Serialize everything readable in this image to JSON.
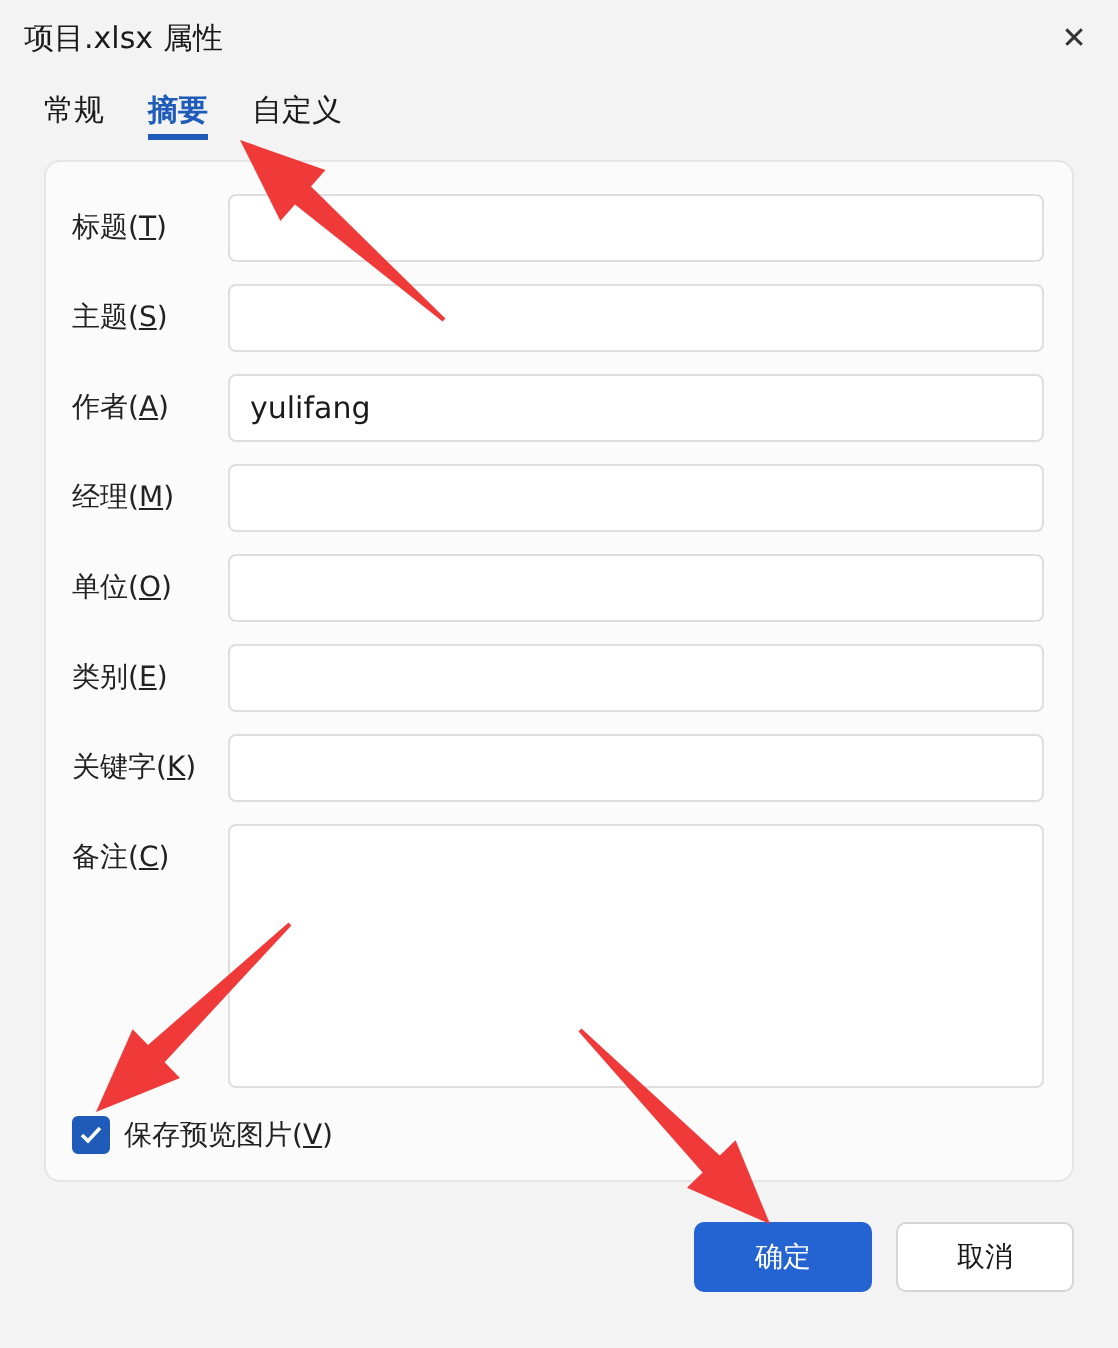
{
  "window": {
    "title": "项目.xlsx 属性",
    "close": "✕"
  },
  "tabs": [
    {
      "label": "常规",
      "selected": false
    },
    {
      "label": "摘要",
      "selected": true
    },
    {
      "label": "自定义",
      "selected": false
    }
  ],
  "fields": [
    {
      "label_before": "标题(",
      "access_key": "T",
      "label_after": ")",
      "kind": "line"
    },
    {
      "label_before": "主题(",
      "access_key": "S",
      "label_after": ")",
      "kind": "line"
    },
    {
      "label_before": "作者(",
      "access_key": "A",
      "label_after": ")",
      "kind": "line",
      "value": "yulifang"
    },
    {
      "label_before": "经理(",
      "access_key": "M",
      "label_after": ")",
      "kind": "line"
    },
    {
      "label_before": "单位(",
      "access_key": "O",
      "label_after": ")",
      "kind": "line"
    },
    {
      "label_before": "类别(",
      "access_key": "E",
      "label_after": ")",
      "kind": "line"
    },
    {
      "label_before": "关键字(",
      "access_key": "K",
      "label_after": ")",
      "kind": "line"
    },
    {
      "label_before": "备注(",
      "access_key": "C",
      "label_after": ")",
      "kind": "multiline"
    }
  ],
  "save_preview": {
    "label_before": "保存预览图片(",
    "access_key": "V",
    "label_after": ")",
    "checked": true
  },
  "buttons": [
    {
      "label": "确定",
      "kind": "primary"
    },
    {
      "label": "取消",
      "kind": "secondary"
    }
  ],
  "annotation_arrows": [
    {
      "kind": "up-left"
    },
    {
      "kind": "down-left"
    },
    {
      "kind": "down-right"
    }
  ]
}
